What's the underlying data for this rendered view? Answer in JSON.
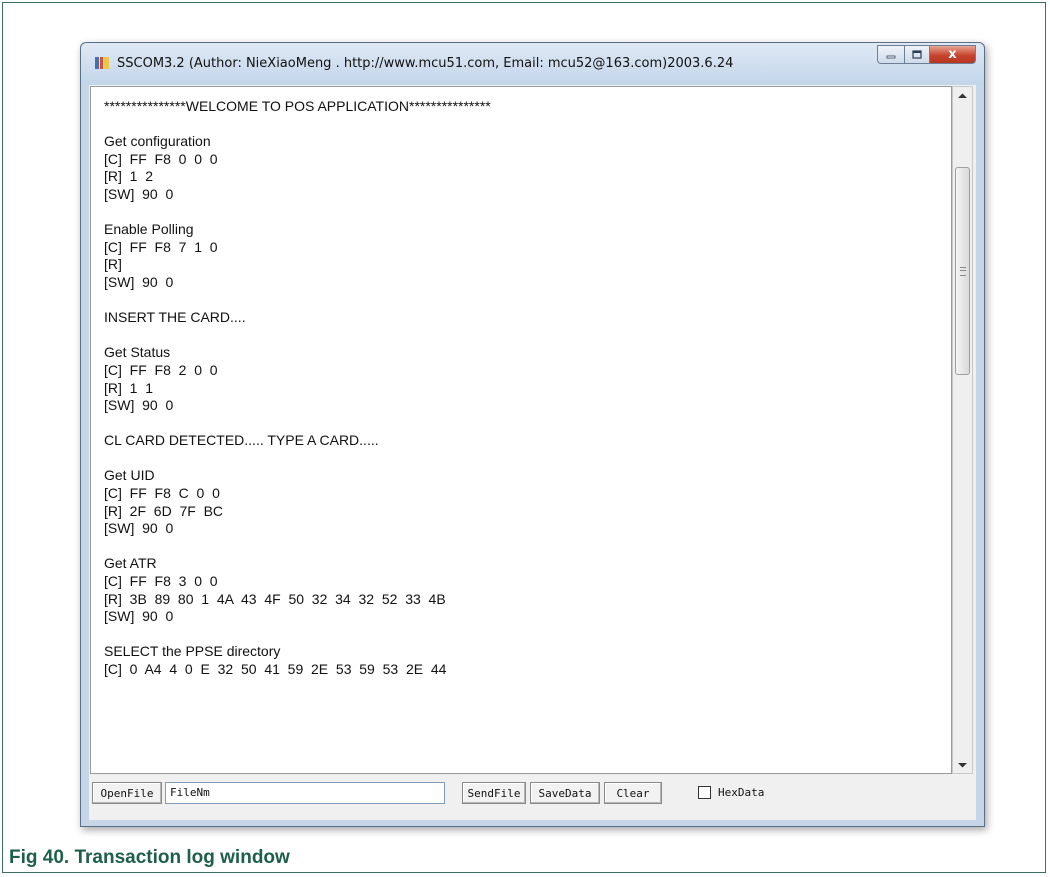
{
  "window": {
    "title": "SSCOM3.2 (Author: NieXiaoMeng .  http://www.mcu51.com,  Email: mcu52@163.com)2003.6.24",
    "close_glyph": "x"
  },
  "log": {
    "lines": [
      "***************WELCOME TO POS APPLICATION***************",
      "",
      "Get configuration",
      "[C]  FF  F8  0  0  0",
      "[R]  1  2",
      "[SW]  90  0",
      "",
      "Enable Polling",
      "[C]  FF  F8  7  1  0",
      "[R]",
      "[SW]  90  0",
      "",
      "INSERT THE CARD....",
      "",
      "Get Status",
      "[C]  FF  F8  2  0  0",
      "[R]  1  1",
      "[SW]  90  0",
      "",
      "CL CARD DETECTED..... TYPE A CARD.....",
      "",
      "Get UID",
      "[C]  FF  F8  C  0  0",
      "[R]  2F  6D  7F  BC",
      "[SW]  90  0",
      "",
      "Get ATR",
      "[C]  FF  F8  3  0  0",
      "[R]  3B  89  80  1  4A  43  4F  50  32  34  32  52  33  4B",
      "[SW]  90  0",
      "",
      "SELECT the PPSE directory",
      "[C]  0  A4  4  0  E  32  50  41  59  2E  53  59  53  2E  44"
    ]
  },
  "toolbar": {
    "open_file": "OpenFile",
    "file_name_value": "FileNm",
    "send_file": "SendFile",
    "save_data": "SaveData",
    "clear": "Clear",
    "hex_data": "HexData",
    "hex_data_checked": false
  },
  "caption": "Fig 40.   Transaction log window",
  "colors": {
    "caption": "#1e5f4c",
    "frame": "#3c6e5e",
    "close_button": "#c7452f"
  }
}
